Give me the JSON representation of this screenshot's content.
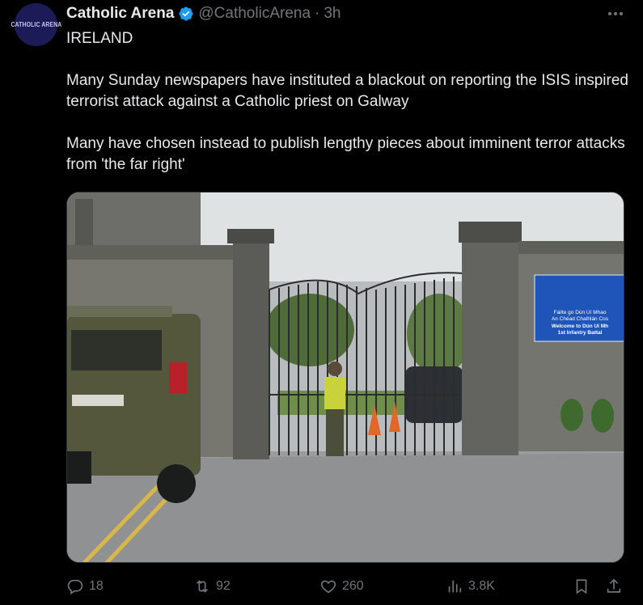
{
  "author": {
    "avatar_text": "CATHOLIC ARENA",
    "name": "Catholic Arena",
    "handle": "@CatholicArena",
    "separator": "·",
    "time": "3h"
  },
  "tweet": {
    "lines": [
      "IRELAND",
      "Many Sunday newspapers have instituted a blackout on reporting the ISIS inspired terrorist attack against a Catholic priest on Galway",
      "Many have chosen instead to publish lengthy pieces about imminent terror attacks from 'the far right'"
    ]
  },
  "media": {
    "sign_lines": [
      "Fáilte go Dún Uí Mhao",
      "An Chéad Chathlán Cos",
      "Welcome to Dún Uí Mh",
      "1st Infantry Battal"
    ]
  },
  "actions": {
    "replies": "18",
    "reposts": "92",
    "likes": "260",
    "views": "3.8K"
  },
  "colors": {
    "background": "#000000",
    "text": "#e7e9ea",
    "muted": "#71767b",
    "verified": "#1d9bf0"
  }
}
